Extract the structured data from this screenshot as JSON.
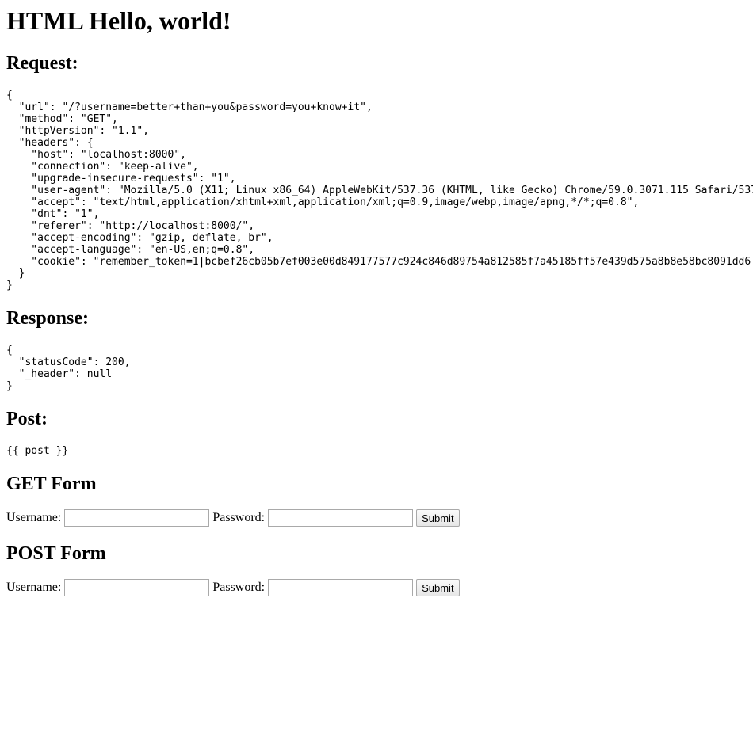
{
  "title": "HTML Hello, world!",
  "request": {
    "heading": "Request:",
    "lines": [
      "{",
      "  \"url\": \"/?username=better+than+you&password=you+know+it\",",
      "  \"method\": \"GET\",",
      "  \"httpVersion\": \"1.1\",",
      "  \"headers\": {",
      "    \"host\": \"localhost:8000\",",
      "    \"connection\": \"keep-alive\",",
      "    \"upgrade-insecure-requests\": \"1\",",
      "    \"user-agent\": \"Mozilla/5.0 (X11; Linux x86_64) AppleWebKit/537.36 (KHTML, like Gecko) Chrome/59.0.3071.115 Safari/537",
      "    \"accept\": \"text/html,application/xhtml+xml,application/xml;q=0.9,image/webp,image/apng,*/*;q=0.8\",",
      "    \"dnt\": \"1\",",
      "    \"referer\": \"http://localhost:8000/\",",
      "    \"accept-encoding\": \"gzip, deflate, br\",",
      "    \"accept-language\": \"en-US,en;q=0.8\",",
      "    \"cookie\": \"remember_token=1|bcbef26cb05b7ef003e00d849177577c924c846d89754a812585f7a45185ff57e439d575a8b8e58bc8091dd6",
      "  }",
      "}"
    ]
  },
  "response": {
    "heading": "Response:",
    "lines": [
      "{",
      "  \"statusCode\": 200,",
      "  \"_header\": null",
      "}"
    ]
  },
  "post": {
    "heading": "Post:",
    "text": "{{ post }}"
  },
  "get_form": {
    "heading": "GET Form",
    "username_label": "Username:",
    "username_value": "",
    "password_label": "Password:",
    "password_value": "",
    "submit_label": "Submit"
  },
  "post_form": {
    "heading": "POST Form",
    "username_label": "Username:",
    "username_value": "",
    "password_label": "Password:",
    "password_value": "",
    "submit_label": "Submit"
  }
}
